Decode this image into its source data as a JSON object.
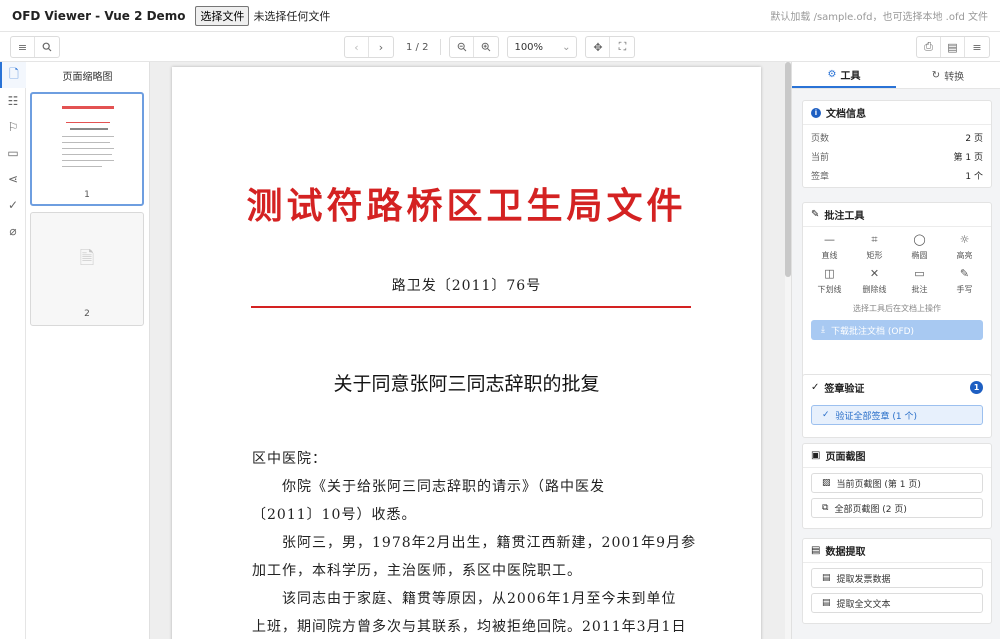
{
  "app": {
    "title": "OFD Viewer - Vue 2 Demo",
    "file_button": "选择文件",
    "file_status": "未选择任何文件",
    "hint": "默认加载 /sample.ofd，也可选择本地 .ofd 文件"
  },
  "toolbar": {
    "page_indicator": "1 / 2",
    "zoom": "100%"
  },
  "thumbnails": {
    "title": "页面缩略图",
    "pages": [
      {
        "num": "1"
      },
      {
        "num": "2"
      }
    ]
  },
  "document": {
    "red_header": "测试符路桥区卫生局文件",
    "doc_number": "路卫发〔2011〕76号",
    "title": "关于同意张阿三同志辞职的批复",
    "lines": [
      "区中医院：",
      "　　你院《关于给张阿三同志辞职的请示》（路中医发",
      "〔2011〕10号）收悉。",
      "　　张阿三，男，1978年2月出生，籍贯江西新建，2001年9月参",
      "加工作，本科学历，主治医师，系区中医院职工。",
      "　　该同志由于家庭、籍贯等原因，从2006年1月至今未到单位",
      "上班，期间院方曾多次与其联系，均被拒绝回院。2011年3月1日"
    ]
  },
  "panel": {
    "tabs": {
      "tools": "工具",
      "convert": "转换"
    },
    "doc_info": {
      "title": "文档信息",
      "rows": [
        {
          "k": "页数",
          "v": "2 页"
        },
        {
          "k": "当前",
          "v": "第 1 页"
        },
        {
          "k": "签章",
          "v": "1 个"
        }
      ]
    },
    "annotate": {
      "title": "批注工具",
      "tools": [
        {
          "icon": "—",
          "label": "直线"
        },
        {
          "icon": "⌗",
          "label": "矩形"
        },
        {
          "icon": "◯",
          "label": "椭圆"
        },
        {
          "icon": "☼",
          "label": "高亮"
        },
        {
          "icon": "◫",
          "label": "下划线"
        },
        {
          "icon": "✕",
          "label": "删除线"
        },
        {
          "icon": "▭",
          "label": "批注"
        },
        {
          "icon": "✎",
          "label": "手写"
        }
      ],
      "hint": "选择工具后在文档上操作",
      "download": "下载批注文档 (OFD)"
    },
    "signature": {
      "title": "签章验证",
      "count": "1",
      "verify": "验证全部签章 (1 个)"
    },
    "screenshot": {
      "title": "页面截图",
      "current": "当前页截图 (第 1 页)",
      "all": "全部页截图 (2 页)"
    },
    "extract": {
      "title": "数据提取",
      "invoice": "提取发票数据",
      "fulltext": "提取全文文本"
    }
  },
  "colors": {
    "accent": "#2a73d6",
    "red_header": "#d42222"
  }
}
